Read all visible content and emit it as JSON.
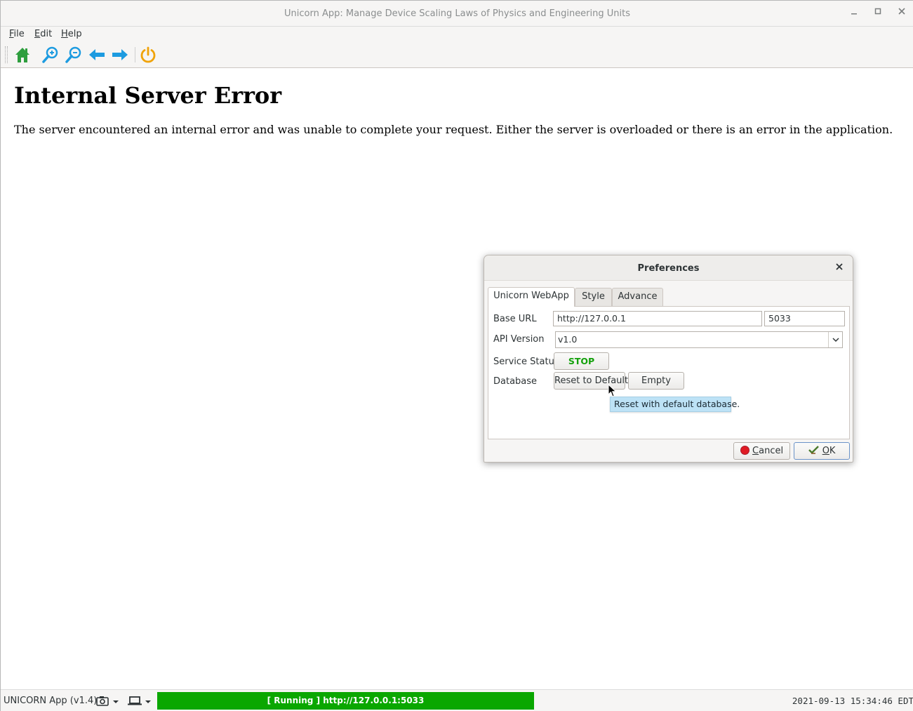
{
  "window": {
    "title": "Unicorn App: Manage Device Scaling Laws of Physics and Engineering Units"
  },
  "menu": [
    {
      "label": "File",
      "mnemonic": "F",
      "rest": "ile"
    },
    {
      "label": "Edit",
      "mnemonic": "E",
      "rest": "dit"
    },
    {
      "label": "Help",
      "mnemonic": "H",
      "rest": "elp"
    }
  ],
  "toolbar": {
    "icons": [
      "home-icon",
      "zoom-in-icon",
      "zoom-out-icon",
      "arrow-left-icon",
      "arrow-right-icon",
      "power-icon"
    ],
    "colors": {
      "home": "#2e9e3e",
      "zoom": "#1d9be0",
      "arrows": "#1d9be0",
      "power": "#f0a30a"
    }
  },
  "page": {
    "heading": "Internal Server Error",
    "message": "The server encountered an internal error and was unable to complete your request. Either the server is overloaded or there is an error in the application."
  },
  "dialog": {
    "title": "Preferences",
    "close_glyph": "✕",
    "tabs": [
      "Unicorn WebApp",
      "Style",
      "Advance"
    ],
    "active_tab": "Unicorn WebApp",
    "fields": {
      "base_url_label": "Base URL",
      "base_url_value": "http://127.0.0.1",
      "port_value": "5033",
      "api_version_label": "API Version",
      "api_version_value": "v1.0",
      "service_status_label": "Service Status",
      "service_button": "STOP",
      "database_label": "Database",
      "reset_button": "Reset to Default",
      "empty_button": "Empty"
    },
    "tooltip": "Reset with default database.",
    "cancel_button": {
      "mnemonic": "C",
      "rest": "ancel"
    },
    "ok_button": {
      "mnemonic": "O",
      "rest": "K"
    }
  },
  "statusbar": {
    "app_version": "UNICORN App (v1.4)",
    "running_text": "[ Running ] http://127.0.0.1:5033",
    "running_color": "#0aa700",
    "timestamp": "2021-09-13 15:34:46 EDT"
  }
}
